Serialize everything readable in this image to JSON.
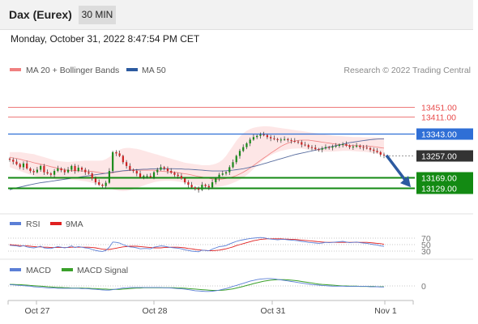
{
  "header": {
    "instrument": "Dax (Eurex)",
    "timeframe": "30 MIN",
    "timestamp": "Monday, October 31, 2022 8:47:54 PM CET"
  },
  "legend": {
    "bollinger": "MA 20 + Bollinger Bands",
    "ma50": "MA 50",
    "credit": "Research © 2022 Trading Central"
  },
  "colors": {
    "resistance": "#e84c4c",
    "pivot": "#2f6fd6",
    "support": "#138a13",
    "candle_up": "#1a8a1a",
    "candle_down": "#cc2222",
    "band_fill": "#fde0e0",
    "ma20": "#f08080",
    "ma50": "#5a6ea0",
    "rsi": "#5b7fd6",
    "rsi_ma": "#e02020",
    "macd": "#5b7fd6",
    "macd_signal": "#3aa02a",
    "forecast_arrow": "#2c5aa0"
  },
  "chart_data": [
    {
      "type": "candlestick",
      "x": [
        "Oct 27",
        "Oct 28",
        "Oct 31",
        "Nov 1"
      ],
      "ylim": [
        13050,
        13560
      ],
      "price_levels": [
        {
          "label": "13451.00",
          "value": 13451,
          "kind": "resistance"
        },
        {
          "label": "13411.00",
          "value": 13411,
          "kind": "resistance"
        },
        {
          "label": "13343.00",
          "value": 13343,
          "kind": "pivot"
        },
        {
          "label": "13257.00",
          "value": 13257,
          "kind": "last"
        },
        {
          "label": "13169.00",
          "value": 13169,
          "kind": "support"
        },
        {
          "label": "13129.00",
          "value": 13129,
          "kind": "support"
        }
      ],
      "close": [
        13240,
        13232,
        13222,
        13210,
        13225,
        13205,
        13195,
        13190,
        13200,
        13215,
        13190,
        13185,
        13180,
        13195,
        13205,
        13198,
        13190,
        13200,
        13215,
        13195,
        13208,
        13200,
        13190,
        13185,
        13165,
        13150,
        13140,
        13135,
        13148,
        13195,
        13270,
        13265,
        13255,
        13230,
        13215,
        13200,
        13195,
        13185,
        13170,
        13175,
        13175,
        13170,
        13190,
        13200,
        13210,
        13205,
        13195,
        13188,
        13180,
        13175,
        13165,
        13150,
        13140,
        13130,
        13125,
        13120,
        13140,
        13135,
        13130,
        13150,
        13165,
        13180,
        13185,
        13190,
        13210,
        13230,
        13255,
        13275,
        13290,
        13305,
        13320,
        13330,
        13335,
        13340,
        13338,
        13330,
        13325,
        13322,
        13318,
        13320,
        13322,
        13318,
        13315,
        13312,
        13310,
        13300,
        13298,
        13290,
        13288,
        13282,
        13280,
        13285,
        13290,
        13288,
        13292,
        13295,
        13300,
        13302,
        13296,
        13290,
        13292,
        13296,
        13290,
        13288,
        13286,
        13280,
        13275,
        13270,
        13260,
        13257
      ],
      "ma20": [
        13250,
        13247,
        13245,
        13242,
        13238,
        13235,
        13232,
        13228,
        13225,
        13222,
        13219,
        13216,
        13212,
        13209,
        13206,
        13203,
        13200,
        13197,
        13196,
        13196,
        13196,
        13195,
        13195,
        13194,
        13193,
        13191,
        13189,
        13187,
        13186,
        13186,
        13188,
        13191,
        13193,
        13195,
        13196,
        13197,
        13198,
        13198,
        13198,
        13198,
        13198,
        13198,
        13198,
        13196,
        13194,
        13193,
        13192,
        13191,
        13190,
        13188,
        13186,
        13184,
        13182,
        13179,
        13176,
        13173,
        13171,
        13168,
        13166,
        13163,
        13162,
        13162,
        13163,
        13165,
        13168,
        13172,
        13177,
        13183,
        13190,
        13198,
        13207,
        13217,
        13227,
        13237,
        13247,
        13256,
        13266,
        13275,
        13284,
        13293,
        13300,
        13306,
        13311,
        13314,
        13317,
        13318,
        13318,
        13318,
        13316,
        13314,
        13312,
        13310,
        13308,
        13306,
        13304,
        13302,
        13300,
        13299,
        13298,
        13297,
        13296,
        13296,
        13295,
        13295,
        13294,
        13293,
        13292,
        13290,
        13288,
        13286
      ],
      "bb_upper": [
        13270,
        13270,
        13270,
        13270,
        13268,
        13266,
        13264,
        13262,
        13258,
        13254,
        13250,
        13246,
        13242,
        13238,
        13235,
        13233,
        13232,
        13231,
        13232,
        13233,
        13234,
        13235,
        13236,
        13236,
        13236,
        13236,
        13236,
        13237,
        13242,
        13250,
        13262,
        13272,
        13280,
        13285,
        13287,
        13287,
        13285,
        13283,
        13280,
        13276,
        13272,
        13268,
        13264,
        13260,
        13256,
        13252,
        13248,
        13244,
        13240,
        13236,
        13232,
        13228,
        13226,
        13224,
        13222,
        13220,
        13218,
        13218,
        13218,
        13220,
        13224,
        13230,
        13240,
        13255,
        13275,
        13295,
        13315,
        13332,
        13345,
        13355,
        13362,
        13367,
        13370,
        13372,
        13373,
        13373,
        13372,
        13370,
        13368,
        13366,
        13364,
        13362,
        13360,
        13358,
        13356,
        13354,
        13352,
        13350,
        13348,
        13346,
        13344,
        13342,
        13340,
        13338,
        13336,
        13335,
        13334,
        13333,
        13332,
        13331,
        13330,
        13330,
        13330,
        13329,
        13329,
        13329,
        13329,
        13328,
        13328,
        13328
      ],
      "bb_lower": [
        13210,
        13205,
        13200,
        13195,
        13190,
        13185,
        13180,
        13175,
        13172,
        13170,
        13168,
        13166,
        13164,
        13163,
        13162,
        13161,
        13160,
        13160,
        13160,
        13159,
        13158,
        13156,
        13154,
        13151,
        13148,
        13144,
        13140,
        13136,
        13132,
        13127,
        13122,
        13118,
        13116,
        13115,
        13116,
        13118,
        13122,
        13127,
        13132,
        13137,
        13142,
        13146,
        13150,
        13153,
        13155,
        13156,
        13156,
        13156,
        13155,
        13153,
        13151,
        13148,
        13145,
        13142,
        13139,
        13136,
        13133,
        13131,
        13130,
        13130,
        13131,
        13133,
        13135,
        13138,
        13142,
        13147,
        13153,
        13160,
        13168,
        13178,
        13190,
        13203,
        13216,
        13228,
        13240,
        13250,
        13258,
        13265,
        13270,
        13275,
        13278,
        13281,
        13283,
        13284,
        13285,
        13284,
        13282,
        13280,
        13278,
        13276,
        13274,
        13273,
        13272,
        13272,
        13272,
        13273,
        13274,
        13275,
        13275,
        13275,
        13274,
        13273,
        13272,
        13271,
        13270,
        13268,
        13266,
        13264,
        13262,
        13260
      ],
      "ma50": [
        13120,
        13124,
        13128,
        13131,
        13134,
        13137,
        13140,
        13143,
        13146,
        13148,
        13150,
        13152,
        13154,
        13156,
        13158,
        13160,
        13162,
        13164,
        13166,
        13168,
        13170,
        13172,
        13174,
        13176,
        13178,
        13180,
        13182,
        13184,
        13186,
        13188,
        13190,
        13192,
        13194,
        13196,
        13197,
        13198,
        13199,
        13200,
        13201,
        13202,
        13202,
        13203,
        13203,
        13204,
        13204,
        13204,
        13204,
        13204,
        13204,
        13203,
        13203,
        13202,
        13202,
        13201,
        13200,
        13199,
        13198,
        13197,
        13196,
        13195,
        13195,
        13195,
        13195,
        13196,
        13197,
        13198,
        13200,
        13202,
        13204,
        13207,
        13210,
        13213,
        13216,
        13220,
        13224,
        13228,
        13232,
        13236,
        13240,
        13244,
        13248,
        13252,
        13256,
        13260,
        13263,
        13266,
        13269,
        13272,
        13275,
        13278,
        13281,
        13284,
        13287,
        13290,
        13293,
        13296,
        13299,
        13302,
        13305,
        13308,
        13310,
        13312,
        13314,
        13316,
        13318,
        13320,
        13321,
        13322,
        13323,
        13323
      ],
      "forecast": [
        {
          "x": "Nov 1",
          "from": 13257,
          "to": 13169
        }
      ]
    },
    {
      "type": "line",
      "name": "RSI",
      "levels": [
        {
          "label": "70",
          "value": 70
        },
        {
          "label": "50",
          "value": 50
        },
        {
          "label": "30",
          "value": 30
        }
      ],
      "ylim": [
        20,
        80
      ],
      "series": [
        {
          "name": "RSI",
          "values": [
            48,
            47,
            46,
            44,
            47,
            43,
            41,
            40,
            42,
            45,
            40,
            39,
            38,
            41,
            44,
            42,
            40,
            42,
            46,
            41,
            44,
            42,
            40,
            39,
            35,
            32,
            30,
            29,
            32,
            42,
            58,
            57,
            55,
            50,
            46,
            43,
            42,
            40,
            37,
            38,
            38,
            37,
            42,
            44,
            46,
            45,
            43,
            41,
            40,
            39,
            37,
            34,
            32,
            30,
            29,
            28,
            33,
            32,
            31,
            36,
            40,
            44,
            45,
            47,
            52,
            56,
            60,
            63,
            65,
            67,
            69,
            70,
            71,
            72,
            71,
            69,
            67,
            66,
            65,
            66,
            66,
            65,
            64,
            63,
            62,
            60,
            59,
            57,
            56,
            55,
            54,
            55,
            57,
            56,
            57,
            58,
            59,
            60,
            58,
            56,
            57,
            58,
            56,
            55,
            54,
            52,
            50,
            49,
            46,
            45
          ]
        },
        {
          "name": "9MA",
          "values": [
            50,
            49,
            48,
            47,
            46,
            46,
            45,
            44,
            43,
            43,
            42,
            42,
            41,
            41,
            41,
            41,
            41,
            41,
            42,
            42,
            42,
            42,
            42,
            42,
            41,
            40,
            38,
            36,
            35,
            35,
            37,
            39,
            41,
            43,
            44,
            45,
            45,
            45,
            44,
            43,
            42,
            41,
            40,
            40,
            40,
            41,
            41,
            42,
            42,
            42,
            41,
            40,
            38,
            37,
            35,
            34,
            33,
            32,
            31,
            31,
            32,
            33,
            35,
            37,
            40,
            43,
            47,
            50,
            53,
            56,
            59,
            62,
            64,
            66,
            67,
            68,
            68,
            68,
            68,
            68,
            67,
            67,
            66,
            66,
            65,
            64,
            63,
            62,
            61,
            60,
            59,
            58,
            57,
            57,
            57,
            57,
            57,
            57,
            57,
            57,
            57,
            57,
            57,
            57,
            57,
            56,
            55,
            54,
            53,
            51
          ]
        }
      ]
    },
    {
      "type": "line",
      "name": "MACD",
      "levels": [
        {
          "label": "0",
          "value": 0
        }
      ],
      "ylim": [
        -40,
        40
      ],
      "series": [
        {
          "name": "MACD",
          "values": [
            5,
            4,
            3,
            2,
            1,
            0,
            -1,
            -3,
            -4,
            -5,
            -6,
            -7,
            -8,
            -8,
            -9,
            -9,
            -9,
            -9,
            -9,
            -9,
            -9,
            -10,
            -10,
            -11,
            -12,
            -13,
            -14,
            -15,
            -16,
            -16,
            -14,
            -12,
            -10,
            -8,
            -7,
            -6,
            -6,
            -6,
            -6,
            -6,
            -6,
            -6,
            -6,
            -6,
            -6,
            -7,
            -7,
            -8,
            -9,
            -10,
            -11,
            -12,
            -14,
            -16,
            -18,
            -19,
            -20,
            -21,
            -21,
            -20,
            -18,
            -16,
            -13,
            -10,
            -6,
            -2,
            2,
            6,
            10,
            14,
            18,
            21,
            24,
            26,
            27,
            28,
            28,
            27,
            25,
            23,
            21,
            19,
            17,
            15,
            13,
            11,
            9,
            7,
            5,
            4,
            3,
            2,
            1,
            0,
            -1,
            -1,
            -1,
            -1,
            -2,
            -2,
            -2,
            -2,
            -2,
            -2,
            -2,
            -3,
            -3,
            -3,
            -4,
            -4
          ]
        },
        {
          "name": "MACD Signal",
          "values": [
            6,
            6,
            5,
            5,
            4,
            3,
            2,
            1,
            0,
            -1,
            -2,
            -3,
            -4,
            -5,
            -6,
            -6,
            -7,
            -7,
            -8,
            -8,
            -8,
            -8,
            -9,
            -9,
            -10,
            -10,
            -11,
            -12,
            -12,
            -13,
            -13,
            -13,
            -13,
            -12,
            -11,
            -10,
            -9,
            -8,
            -8,
            -7,
            -7,
            -7,
            -7,
            -7,
            -7,
            -7,
            -7,
            -7,
            -7,
            -8,
            -8,
            -9,
            -10,
            -11,
            -12,
            -13,
            -14,
            -15,
            -16,
            -17,
            -17,
            -17,
            -16,
            -15,
            -13,
            -11,
            -8,
            -5,
            -2,
            2,
            5,
            9,
            12,
            15,
            18,
            20,
            22,
            23,
            24,
            24,
            24,
            23,
            22,
            21,
            19,
            17,
            15,
            13,
            11,
            9,
            7,
            6,
            5,
            4,
            3,
            2,
            1,
            0,
            0,
            -1,
            -1,
            -1,
            -2,
            -2,
            -2,
            -2,
            -2,
            -3,
            -3,
            -3
          ]
        }
      ]
    }
  ]
}
